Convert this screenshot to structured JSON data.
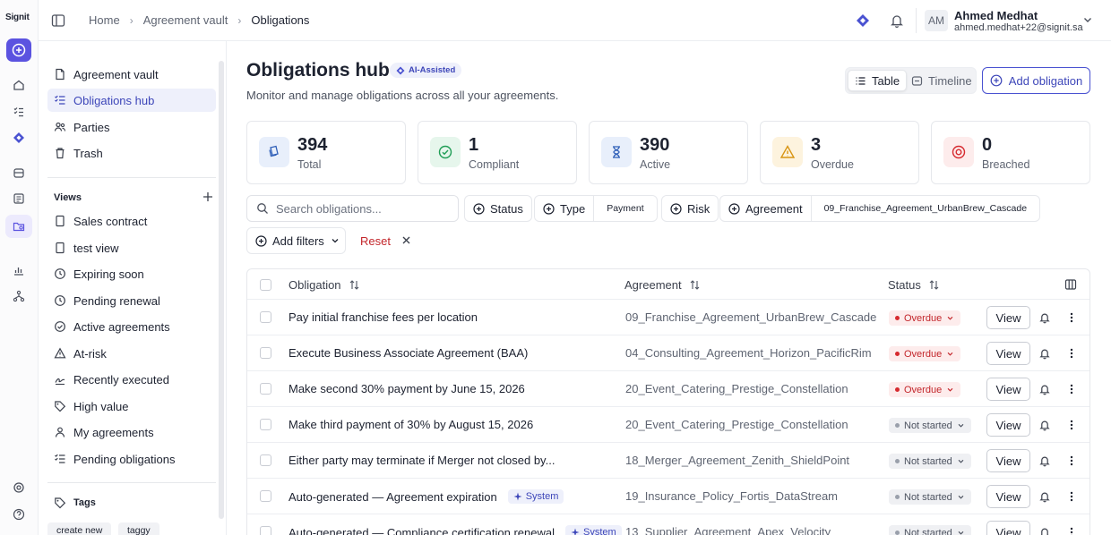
{
  "app": {
    "logo_text": "Signit"
  },
  "breadcrumb": [
    "Home",
    "Agreement vault",
    "Obligations"
  ],
  "user": {
    "initials": "AM",
    "name": "Ahmed Medhat",
    "email": "ahmed.medhat+22@signit.sa"
  },
  "sidebar": {
    "top_items": [
      {
        "label": "Agreement vault",
        "icon": "document-icon"
      },
      {
        "label": "Obligations hub",
        "icon": "checklist-icon",
        "active": true
      },
      {
        "label": "Parties",
        "icon": "users-icon"
      },
      {
        "label": "Trash",
        "icon": "trash-icon"
      }
    ],
    "views_heading": "Views",
    "views": [
      {
        "label": "Sales contract",
        "icon": "doc-icon"
      },
      {
        "label": "test view",
        "icon": "doc-icon"
      },
      {
        "label": "Expiring soon",
        "icon": "clock-icon"
      },
      {
        "label": "Pending renewal",
        "icon": "clock-icon"
      },
      {
        "label": "Active agreements",
        "icon": "check-circle-icon"
      },
      {
        "label": "At-risk",
        "icon": "warning-icon"
      },
      {
        "label": "Recently executed",
        "icon": "signature-icon"
      },
      {
        "label": "High value",
        "icon": "tag-icon"
      },
      {
        "label": "My agreements",
        "icon": "user-icon"
      },
      {
        "label": "Pending obligations",
        "icon": "checklist-icon"
      }
    ],
    "tags_heading": "Tags",
    "tags": [
      "create new",
      "taggy"
    ]
  },
  "main": {
    "title": "Obligations hub",
    "ai_badge": "AI-Assisted",
    "subtitle": "Monitor and manage obligations across all your agreements.",
    "view_toggle": {
      "table": "Table",
      "timeline": "Timeline"
    },
    "add_button": "Add obligation",
    "stats": [
      {
        "value": "394",
        "label": "Total",
        "color": "#2f5fb8",
        "bg": "#e8effb"
      },
      {
        "value": "1",
        "label": "Compliant",
        "color": "#1f9d55",
        "bg": "#e6f6ec"
      },
      {
        "value": "390",
        "label": "Active",
        "color": "#2f5fb8",
        "bg": "#e8effb"
      },
      {
        "value": "3",
        "label": "Overdue",
        "color": "#d89412",
        "bg": "#fdf3de"
      },
      {
        "value": "0",
        "label": "Breached",
        "color": "#d62a2f",
        "bg": "#fdecec"
      }
    ],
    "search_placeholder": "Search obligations...",
    "filters": {
      "status": "Status",
      "type": "Type",
      "type_value": "Payment",
      "risk": "Risk",
      "agreement": "Agreement",
      "agreement_value": "09_Franchise_Agreement_UrbanBrew_Cascade",
      "add_filters": "Add filters",
      "reset": "Reset"
    },
    "table": {
      "headers": {
        "obligation": "Obligation",
        "agreement": "Agreement",
        "status": "Status"
      },
      "view_label": "View",
      "system_label": "System",
      "rows": [
        {
          "obligation": "Pay initial franchise fees per location",
          "agreement": "09_Franchise_Agreement_UrbanBrew_Cascade",
          "status": "Overdue",
          "kind": "overdue"
        },
        {
          "obligation": "Execute Business Associate Agreement (BAA)",
          "agreement": "04_Consulting_Agreement_Horizon_PacificRim",
          "status": "Overdue",
          "kind": "overdue"
        },
        {
          "obligation": "Make second 30% payment by June 15, 2026",
          "agreement": "20_Event_Catering_Prestige_Constellation",
          "status": "Overdue",
          "kind": "overdue"
        },
        {
          "obligation": "Make third payment of 30% by August 15, 2026",
          "agreement": "20_Event_Catering_Prestige_Constellation",
          "status": "Not started",
          "kind": "notstarted"
        },
        {
          "obligation": "Either party may terminate if Merger not closed by...",
          "agreement": "18_Merger_Agreement_Zenith_ShieldPoint",
          "status": "Not started",
          "kind": "notstarted"
        },
        {
          "obligation": "Auto-generated — Agreement expiration",
          "agreement": "19_Insurance_Policy_Fortis_DataStream",
          "status": "Not started",
          "kind": "notstarted",
          "system": true
        },
        {
          "obligation": "Auto-generated — Compliance certification renewal",
          "agreement": "13_Supplier_Agreement_Apex_Velocity",
          "status": "Not started",
          "kind": "notstarted",
          "system": true
        }
      ]
    }
  }
}
